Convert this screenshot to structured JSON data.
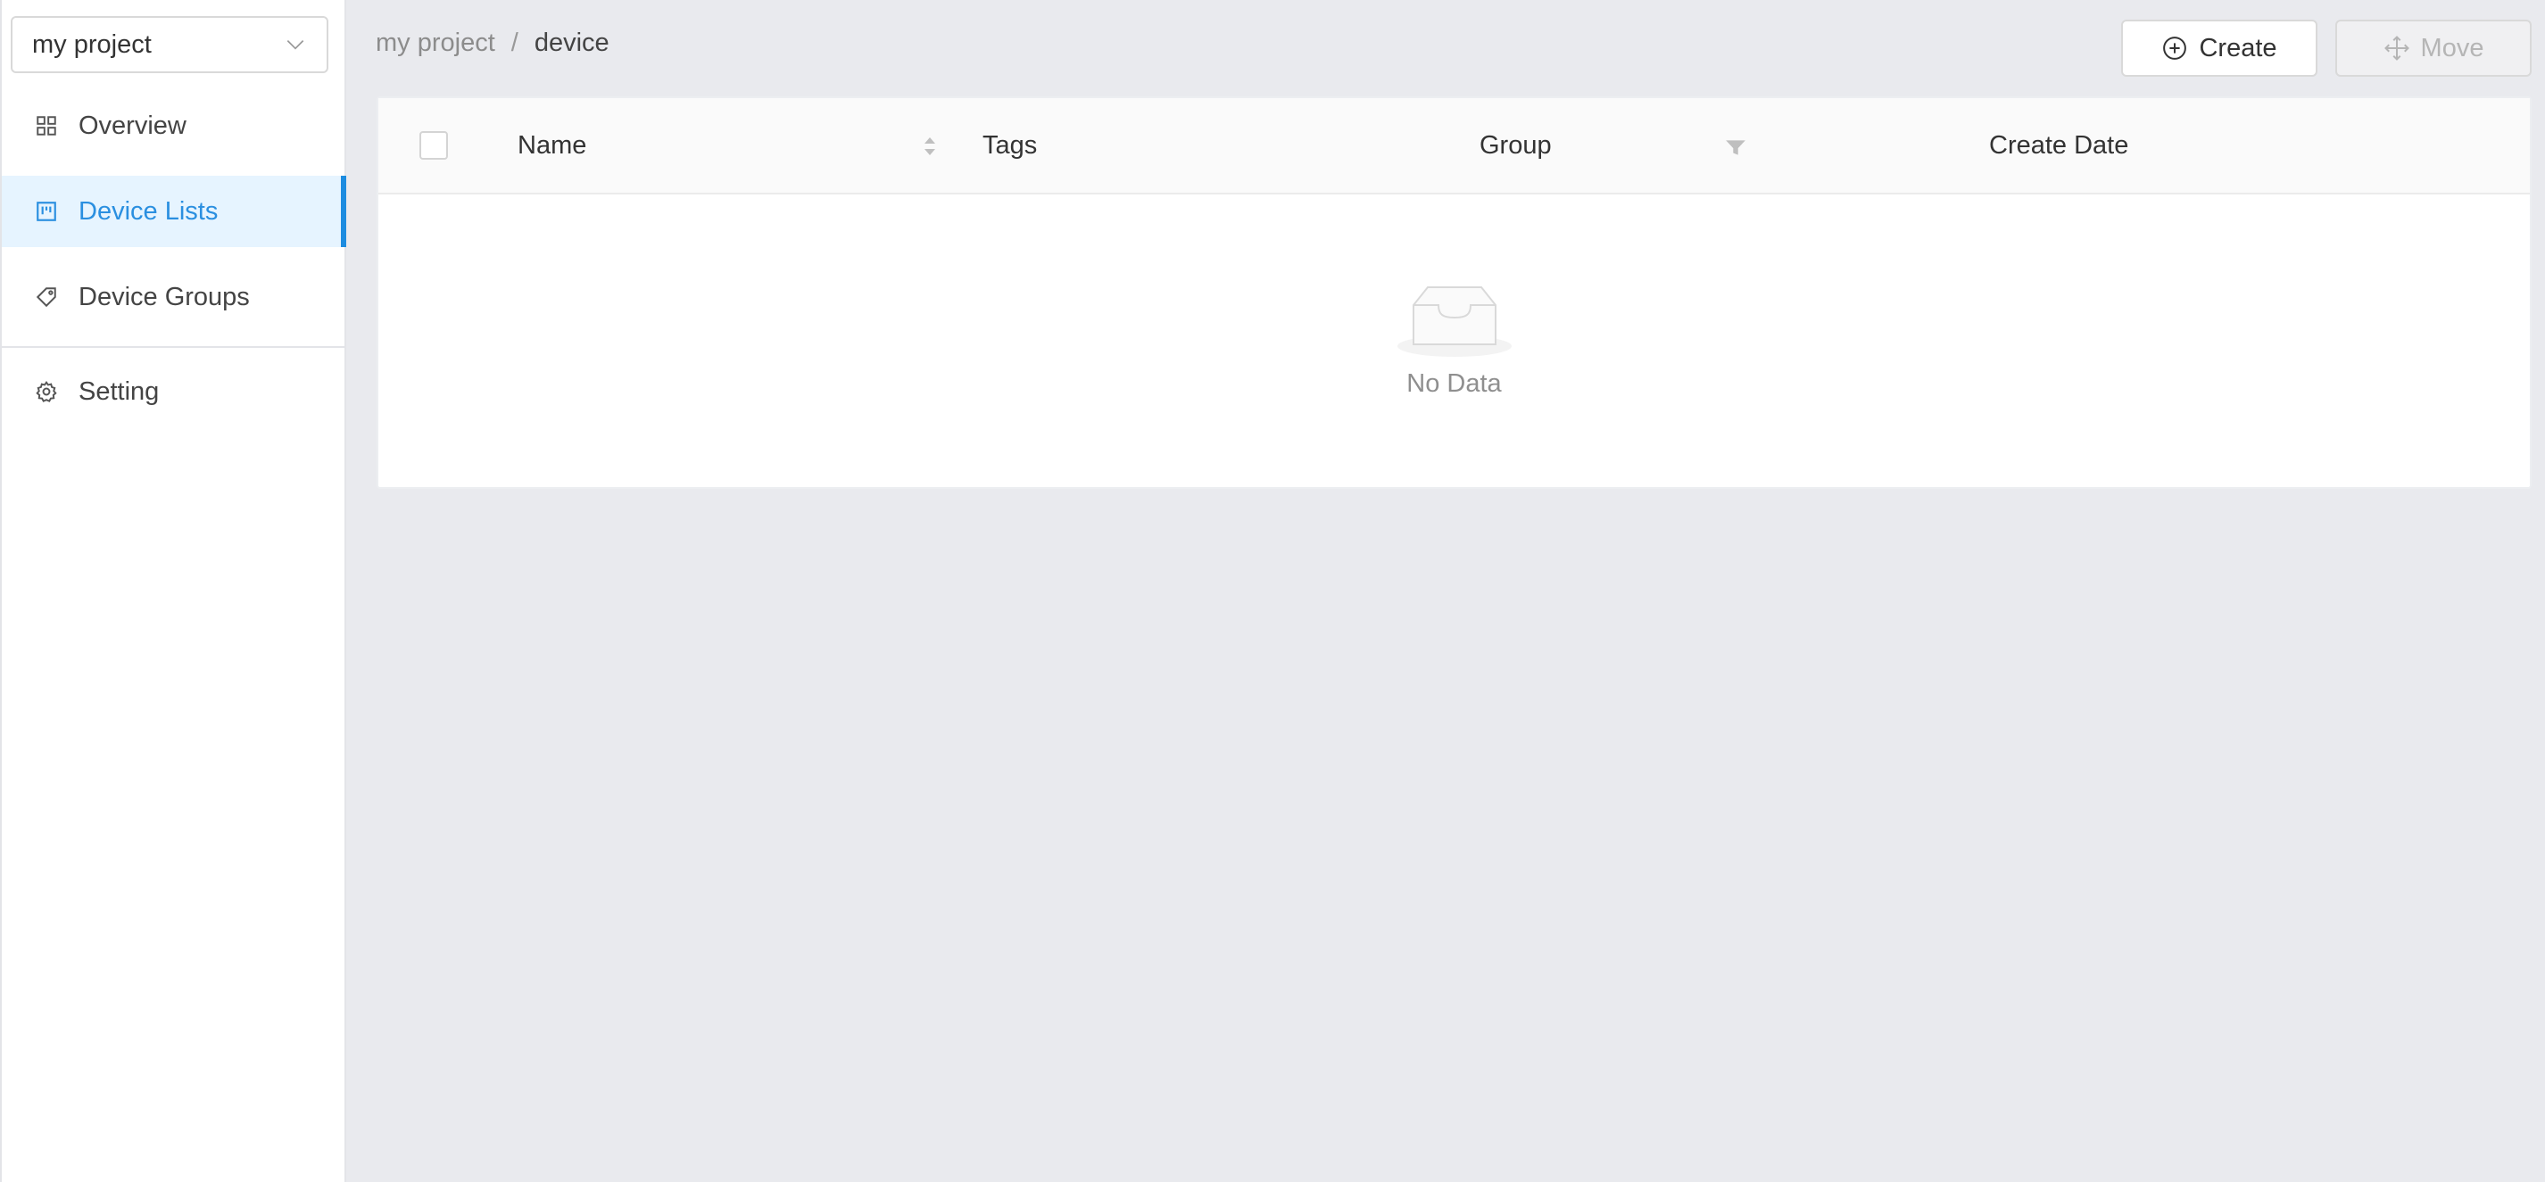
{
  "sidebar": {
    "project_select": {
      "value": "my project",
      "icon": "chevron-down-icon"
    },
    "items": [
      {
        "label": "Overview",
        "icon": "dashboard-grid-icon",
        "active": false
      },
      {
        "label": "Device Lists",
        "icon": "project-board-icon",
        "active": true
      },
      {
        "label": "Device Groups",
        "icon": "tag-icon",
        "active": false
      },
      {
        "label": "Setting",
        "icon": "gear-icon",
        "active": false
      }
    ]
  },
  "header": {
    "breadcrumb": {
      "parent": "my project",
      "separator": "/",
      "current": "device"
    },
    "create_label": "Create",
    "move_label": "Move"
  },
  "table": {
    "columns": {
      "name": "Name",
      "tags": "Tags",
      "group": "Group",
      "create_date": "Create Date"
    },
    "empty_text": "No Data"
  },
  "colors": {
    "accent": "#1d8ce0",
    "active_bg": "#e6f4ff",
    "page_bg": "#e9eaee"
  }
}
